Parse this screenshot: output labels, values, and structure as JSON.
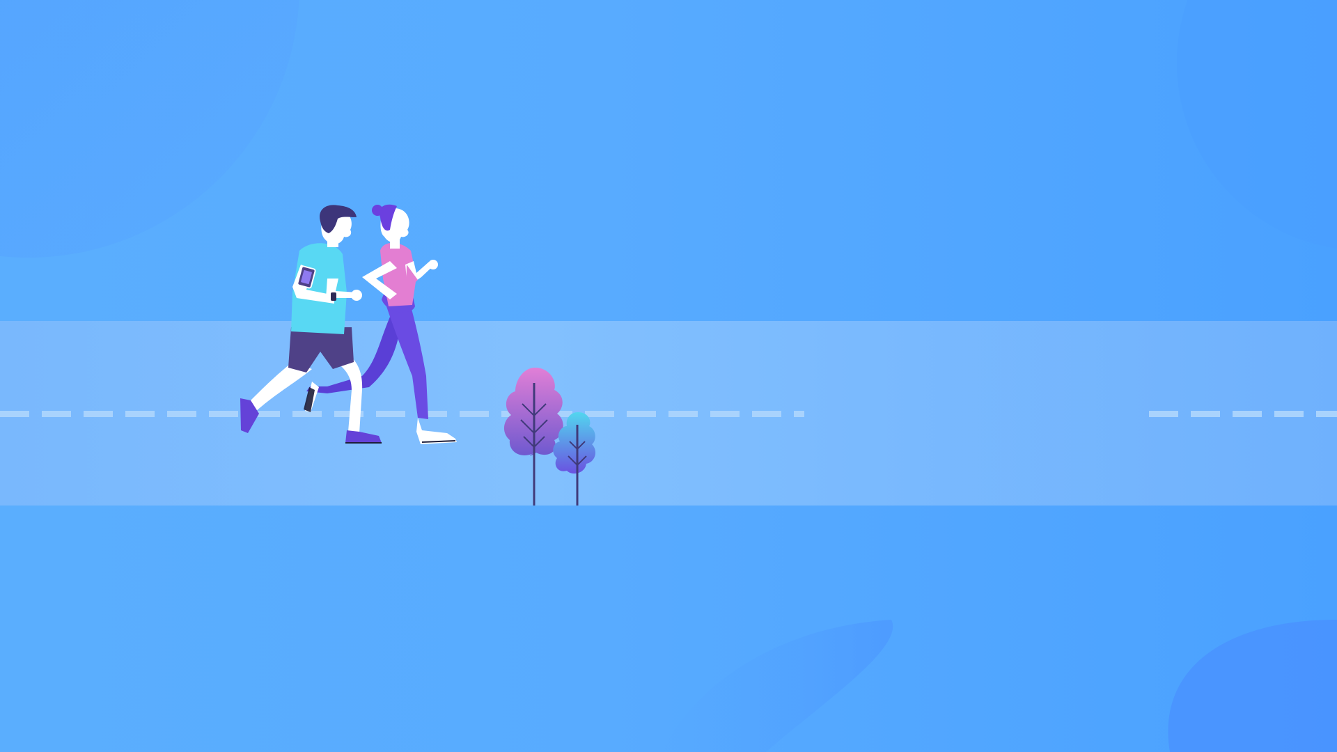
{
  "scene": {
    "colors": {
      "sky": "#55a7ff",
      "sky_dark": "#4797ff",
      "road": "#80bdfd",
      "road_dashes": "#a9d3fd",
      "man_shirt": "#58d8f3",
      "man_shorts": "#4f4187",
      "man_hair": "#3d357a",
      "woman_top": "#e37ed2",
      "woman_leggings": "#6a4be3",
      "woman_hair": "#6b40df",
      "shoes": "#6442d8",
      "skin": "#ffffff",
      "leaf_pink": "#d37bd0",
      "leaf_violet": "#7b5ed3",
      "leaf_teal": "#4fd1ee",
      "stem": "#403a7a"
    },
    "icons": [
      "smartphone-armband-icon",
      "wristwatch-icon"
    ]
  }
}
